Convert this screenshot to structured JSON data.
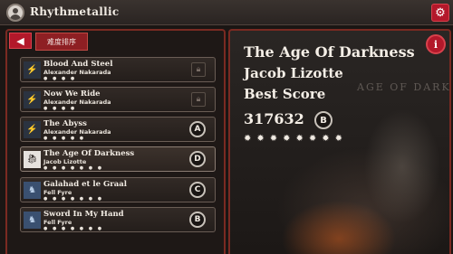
{
  "app": {
    "title": "Rhythmetallic"
  },
  "toolbar": {
    "back_icon": "◀",
    "sort_label": "难度排序"
  },
  "songs": [
    {
      "name": "Blood And Steel",
      "artist": "Alexander Nakarada",
      "stars": "● ● ● ●",
      "status": "locked",
      "grade": "",
      "thumb": "bolt-icon"
    },
    {
      "name": "Now We Ride",
      "artist": "Alexander Nakarada",
      "stars": "● ● ● ●",
      "status": "locked",
      "grade": "",
      "thumb": "bolt-icon"
    },
    {
      "name": "The Abyss",
      "artist": "Alexander Nakarada",
      "stars": "● ● ● ● ●",
      "status": "graded",
      "grade": "A",
      "thumb": "bolt-icon"
    },
    {
      "name": "The Age Of Darkness",
      "artist": "Jacob Lizotte",
      "stars": "● ● ● ● ● ● ●",
      "status": "graded",
      "grade": "D",
      "thumb": "dragon-icon"
    },
    {
      "name": "Galahad et le Graal",
      "artist": "Fell Fyre",
      "stars": "● ● ● ● ● ● ●",
      "status": "graded",
      "grade": "C",
      "thumb": "knight-icon"
    },
    {
      "name": "Sword In My Hand",
      "artist": "Fell Fyre",
      "stars": "● ● ● ● ● ● ●",
      "status": "graded",
      "grade": "B",
      "thumb": "knight-icon"
    }
  ],
  "detail": {
    "title": "The Age Of Darkness",
    "artist": "Jacob Lizotte",
    "best_label": "Best Score",
    "score": "317632",
    "grade": "B",
    "stars": "✹✹✹✹✹✹✹✹",
    "art_text": "AGE OF DARKN",
    "info_icon": "i"
  },
  "colors": {
    "accent_red": "#b3182a",
    "panel_border": "#7a2a22"
  }
}
